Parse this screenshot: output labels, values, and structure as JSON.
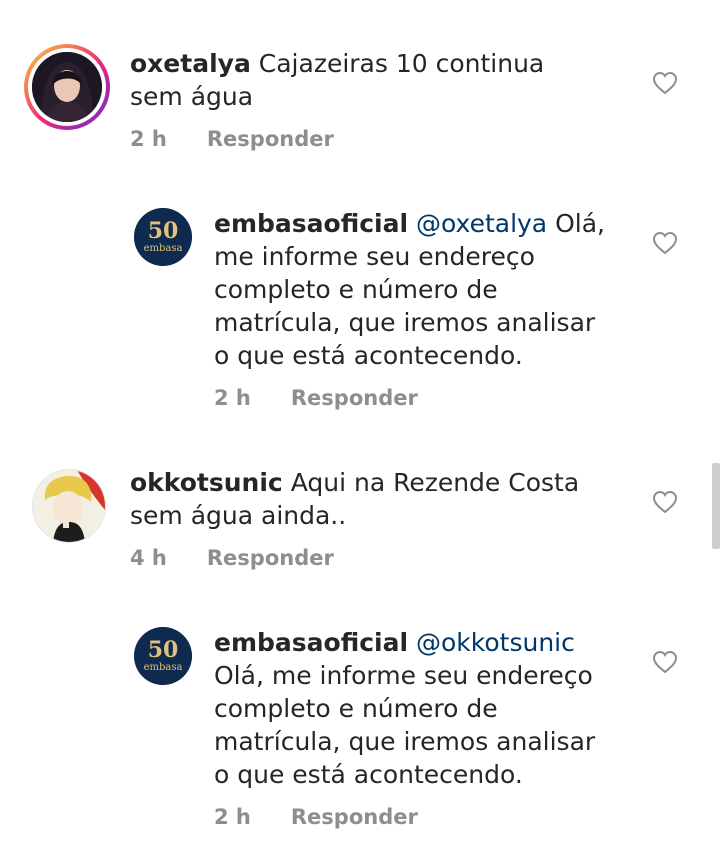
{
  "comments": [
    {
      "username": "oxetalya",
      "mention": "",
      "text": "Cajazeiras 10 continua sem água",
      "time": "2 h",
      "reply_label": "Responder"
    },
    {
      "username": "embasaoficial",
      "mention": "@oxetalya",
      "text": "Olá, me informe seu endereço completo e número de matrícula, que iremos analisar o que está acontecendo.",
      "time": "2 h",
      "reply_label": "Responder",
      "avatar_text": "50 embasa"
    },
    {
      "username": "okkotsunic",
      "mention": "",
      "text": "Aqui na Rezende Costa sem água ainda..",
      "time": "4 h",
      "reply_label": "Responder"
    },
    {
      "username": "embasaoficial",
      "mention": "@okkotsunic",
      "text": "Olá, me informe seu endereço completo e número de matrícula, que iremos analisar o que está acontecendo.",
      "time": "2 h",
      "reply_label": "Responder",
      "avatar_text": "50 embasa"
    }
  ],
  "icons": {
    "like": "heart-outline-icon"
  },
  "colors": {
    "mention": "#00376b",
    "meta": "#8e8e8e",
    "text": "#262626"
  }
}
